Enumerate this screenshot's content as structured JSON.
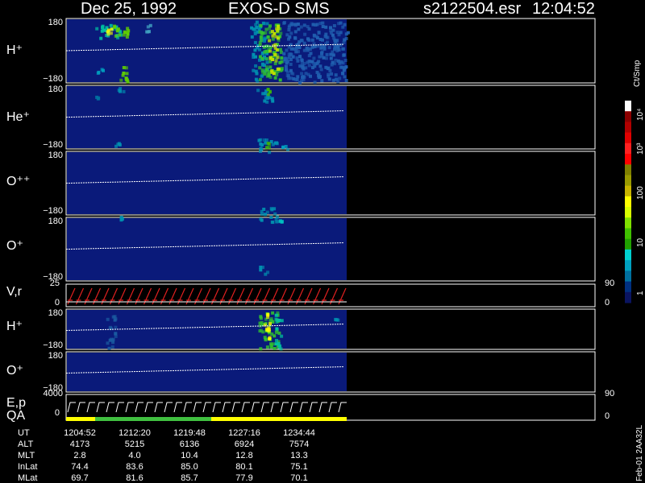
{
  "header": {
    "date": "Dec 25, 1992",
    "instrument": "EXOS-D SMS",
    "filename": "s2122504.esr",
    "time": "12:04:52"
  },
  "colorbar": {
    "unit_label": "Ct/Smp",
    "tick_labels": [
      "10⁴",
      "10³",
      "100",
      "10",
      "1"
    ],
    "colors": [
      "#ffffff",
      "#8b0000",
      "#b00000",
      "#e00000",
      "#ff2020",
      "#ff0000",
      "#808000",
      "#9a9a00",
      "#c8b400",
      "#ffff00",
      "#d8ff00",
      "#80e000",
      "#40c000",
      "#20a000",
      "#00d0d0",
      "#00a0c0",
      "#0070a0",
      "#003080",
      "#0a1460"
    ]
  },
  "chart_data": [
    {
      "type": "heatmap",
      "panel": "H+",
      "ylabel": "H⁺",
      "yticks": [
        "180",
        "−180"
      ],
      "colorscale": "log counts (Ct/Smp)"
    },
    {
      "type": "heatmap",
      "panel": "He+",
      "ylabel": "He⁺",
      "yticks": [
        "180",
        "−180"
      ]
    },
    {
      "type": "heatmap",
      "panel": "O++",
      "ylabel": "O⁺⁺",
      "yticks": [
        "180",
        "−180"
      ]
    },
    {
      "type": "heatmap",
      "panel": "O+",
      "ylabel": "O⁺",
      "yticks": [
        "180",
        "−180"
      ]
    },
    {
      "type": "line",
      "panel": "V,r",
      "ylabel": "V,r",
      "yticks_left": [
        "25",
        "0"
      ],
      "yticks_right": [
        "90",
        "0"
      ]
    },
    {
      "type": "heatmap",
      "panel": "H+ (2)",
      "ylabel": "H⁺",
      "yticks": [
        "180",
        "−180"
      ]
    },
    {
      "type": "heatmap",
      "panel": "O+ (2)",
      "ylabel": "O⁺",
      "yticks": [
        "180",
        "−180"
      ]
    },
    {
      "type": "line",
      "panel": "E,p QA",
      "ylabel": "E,p",
      "ylabel2": "QA",
      "yticks_left": [
        "4000",
        "0"
      ],
      "yticks_right": [
        "90",
        "0"
      ]
    }
  ],
  "ephemeris": {
    "row_labels": [
      "UT",
      "ALT",
      "MLT",
      "InLat",
      "MLat"
    ],
    "columns": [
      [
        "1204:52",
        "4173",
        "2.8",
        "74.4",
        "69.7"
      ],
      [
        "1212:20",
        "5215",
        "4.0",
        "83.6",
        "81.6"
      ],
      [
        "1219:48",
        "6136",
        "10.4",
        "85.0",
        "85.7"
      ],
      [
        "1227:16",
        "6924",
        "12.8",
        "80.1",
        "77.9"
      ],
      [
        "1234:44",
        "7574",
        "13.3",
        "75.1",
        "70.1"
      ]
    ]
  },
  "footer": {
    "side_text": "Feb-01 2AA32L"
  }
}
